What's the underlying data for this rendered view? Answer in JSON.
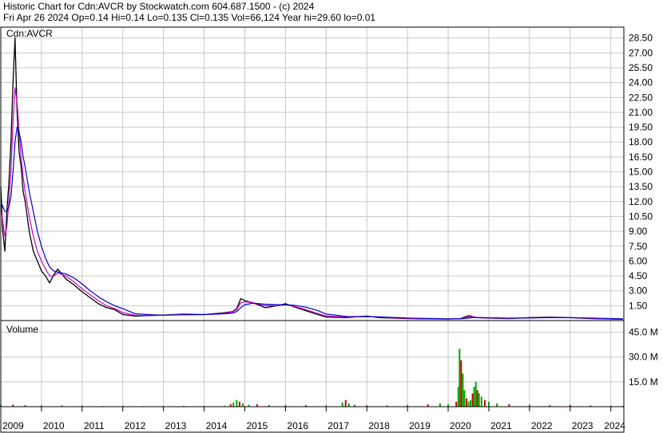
{
  "header": {
    "title_line": "Historic Chart for Cdn:AVCR by Stockwatch.com 604.687.1500 - (c) 2024",
    "quote_line": "Fri Apr 26 2024  Op=0.14  Hi=0.14  Lo=0.135  Cl=0.135  Vol=66,124  Year hi=29.60  lo=0.01"
  },
  "colors": {
    "price_bars": "#000000",
    "price_bars_down": "#cc0000",
    "ma_short": "#cc00cc",
    "ma_long": "#0000cc",
    "volume_up": "#00aa00",
    "volume_down": "#cc0000",
    "grid": "#c8c8c8"
  },
  "chart_data": [
    {
      "type": "line",
      "label": "Cdn:AVCR",
      "y_ticks": [
        "1.50",
        "3.00",
        "4.50",
        "6.00",
        "7.50",
        "9.00",
        "10.50",
        "12.00",
        "13.50",
        "15.00",
        "16.50",
        "18.00",
        "19.50",
        "21.00",
        "22.50",
        "24.00",
        "25.50",
        "27.00",
        "28.50"
      ],
      "ylim": [
        0,
        29.6
      ],
      "x_ticks": [
        "2009",
        "2010",
        "2011",
        "2012",
        "2013",
        "2014",
        "2015",
        "2016",
        "2017",
        "2018",
        "2019",
        "2020",
        "2021",
        "2022",
        "2023",
        "2024"
      ],
      "x": [
        2009.0,
        2009.05,
        2009.1,
        2009.15,
        2009.2,
        2009.25,
        2009.3,
        2009.35,
        2009.4,
        2009.45,
        2009.5,
        2009.55,
        2009.6,
        2009.7,
        2009.8,
        2009.9,
        2010.0,
        2010.1,
        2010.2,
        2010.3,
        2010.4,
        2010.6,
        2010.8,
        2011.0,
        2011.2,
        2011.4,
        2011.6,
        2011.8,
        2012.0,
        2012.3,
        2012.6,
        2013.0,
        2013.5,
        2014.0,
        2014.5,
        2014.7,
        2014.8,
        2014.9,
        2015.0,
        2015.2,
        2015.5,
        2015.8,
        2016.0,
        2016.2,
        2016.5,
        2016.8,
        2017.0,
        2017.5,
        2018.0,
        2018.3,
        2018.6,
        2019.0,
        2019.5,
        2020.0,
        2020.3,
        2020.5,
        2020.6,
        2020.7,
        2021.0,
        2021.5,
        2022.0,
        2022.5,
        2023.0,
        2023.5,
        2024.0,
        2024.3
      ],
      "series": [
        {
          "name": "",
          "values": [
            13.5,
            9.0,
            7.0,
            11.0,
            14.0,
            18.0,
            24.0,
            28.5,
            21.0,
            17.0,
            15.5,
            13.0,
            12.0,
            9.0,
            7.0,
            6.0,
            5.0,
            4.5,
            3.8,
            4.6,
            5.2,
            4.2,
            3.6,
            2.9,
            2.3,
            1.7,
            1.3,
            1.1,
            0.6,
            0.45,
            0.5,
            0.55,
            0.65,
            0.6,
            0.8,
            0.9,
            1.2,
            2.2,
            2.0,
            1.8,
            1.3,
            1.5,
            1.7,
            1.4,
            1.0,
            0.6,
            0.35,
            0.3,
            0.45,
            0.3,
            0.25,
            0.2,
            0.18,
            0.15,
            0.2,
            0.5,
            0.4,
            0.3,
            0.25,
            0.2,
            0.3,
            0.35,
            0.3,
            0.2,
            0.15,
            0.135
          ]
        },
        {
          "name": "",
          "values": [
            11.5,
            10.0,
            8.5,
            9.5,
            12.0,
            15.0,
            20.0,
            23.5,
            22.0,
            19.0,
            16.5,
            14.5,
            13.0,
            10.5,
            8.5,
            7.0,
            6.0,
            5.2,
            4.5,
            4.5,
            4.8,
            4.5,
            3.9,
            3.2,
            2.6,
            2.0,
            1.5,
            1.2,
            0.8,
            0.55,
            0.5,
            0.55,
            0.6,
            0.6,
            0.75,
            0.85,
            1.1,
            1.8,
            1.9,
            1.8,
            1.5,
            1.5,
            1.6,
            1.45,
            1.1,
            0.7,
            0.45,
            0.35,
            0.4,
            0.35,
            0.28,
            0.22,
            0.19,
            0.16,
            0.19,
            0.35,
            0.38,
            0.32,
            0.27,
            0.22,
            0.27,
            0.32,
            0.3,
            0.22,
            0.17,
            0.15
          ]
        },
        {
          "name": "",
          "values": [
            12.0,
            11.5,
            11.0,
            11.0,
            11.5,
            12.5,
            15.0,
            18.0,
            19.5,
            19.0,
            18.0,
            16.5,
            15.5,
            13.0,
            11.0,
            9.0,
            7.5,
            6.3,
            5.4,
            5.0,
            4.9,
            4.7,
            4.3,
            3.7,
            3.0,
            2.4,
            1.9,
            1.5,
            1.2,
            0.7,
            0.6,
            0.55,
            0.58,
            0.6,
            0.68,
            0.75,
            0.9,
            1.3,
            1.6,
            1.75,
            1.65,
            1.6,
            1.6,
            1.55,
            1.35,
            1.0,
            0.65,
            0.42,
            0.4,
            0.37,
            0.32,
            0.26,
            0.21,
            0.18,
            0.18,
            0.25,
            0.3,
            0.3,
            0.28,
            0.24,
            0.26,
            0.3,
            0.3,
            0.25,
            0.2,
            0.17
          ]
        }
      ]
    },
    {
      "type": "bar",
      "label": "Volume",
      "y_ticks": [
        "15.0 M",
        "30.0 M",
        "45.0 M"
      ],
      "ylim": [
        0,
        52
      ],
      "series_name": "",
      "x": [
        2009.0,
        2009.3,
        2009.6,
        2010.0,
        2010.5,
        2011.0,
        2011.5,
        2012.0,
        2012.5,
        2013.0,
        2013.5,
        2014.0,
        2014.5,
        2014.65,
        2014.72,
        2014.8,
        2014.87,
        2014.95,
        2015.1,
        2015.3,
        2015.6,
        2016.0,
        2016.5,
        2017.0,
        2017.4,
        2017.48,
        2017.56,
        2017.7,
        2018.0,
        2018.5,
        2019.0,
        2019.5,
        2019.8,
        2020.0,
        2020.2,
        2020.25,
        2020.28,
        2020.32,
        2020.36,
        2020.4,
        2020.45,
        2020.5,
        2020.55,
        2020.6,
        2020.64,
        2020.68,
        2020.72,
        2020.76,
        2020.82,
        2020.9,
        2021.0,
        2021.2,
        2021.5,
        2022.0,
        2022.5,
        2023.0,
        2023.5,
        2024.0,
        2024.3
      ],
      "values": [
        1.0,
        1.2,
        0.9,
        0.8,
        0.7,
        0.6,
        0.5,
        0.4,
        0.4,
        0.4,
        0.5,
        0.5,
        0.6,
        1.5,
        2.5,
        4.0,
        3.0,
        2.0,
        1.2,
        1.5,
        1.0,
        1.0,
        0.8,
        0.8,
        2.5,
        4.0,
        2.0,
        1.2,
        0.8,
        0.8,
        1.0,
        1.5,
        2.0,
        1.5,
        3.0,
        12.0,
        35.0,
        28.0,
        20.0,
        10.0,
        5.0,
        3.0,
        4.0,
        8.0,
        12.0,
        15.0,
        10.0,
        8.0,
        6.0,
        4.0,
        3.0,
        2.0,
        1.5,
        1.2,
        1.0,
        1.0,
        0.8,
        0.6,
        0.5
      ]
    }
  ]
}
